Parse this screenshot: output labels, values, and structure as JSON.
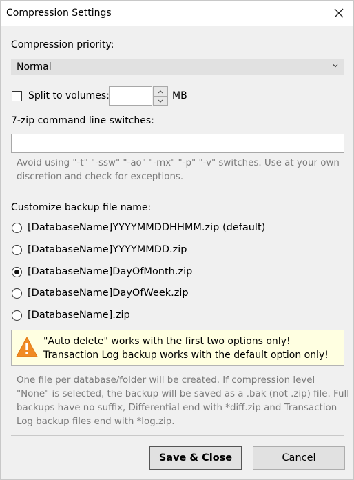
{
  "window": {
    "title": "Compression Settings"
  },
  "compression_priority": {
    "label": "Compression priority:",
    "selected": "Normal"
  },
  "split": {
    "label": "Split to volumes:",
    "checked": false,
    "value": "",
    "unit": "MB"
  },
  "switches": {
    "label": "7-zip command line switches:",
    "value": "",
    "hint_lines": [
      "Avoid using \"-t\" \"-ssw\" \"-ao\" \"-mx\" \"-p\" \"-v\" switches. Use at your own",
      "discretion and check for exceptions."
    ]
  },
  "backup_name": {
    "label": "Customize backup file name:",
    "options": [
      {
        "label": "[DatabaseName]YYYYMMDDHHMM.zip (default)",
        "checked": false
      },
      {
        "label": "[DatabaseName]YYYYMMDD.zip",
        "checked": false
      },
      {
        "label": "[DatabaseName]DayOfMonth.zip",
        "checked": true
      },
      {
        "label": "[DatabaseName]DayOfWeek.zip",
        "checked": false
      },
      {
        "label": "[DatabaseName].zip",
        "checked": false
      }
    ]
  },
  "warning": {
    "icon": "warning-icon",
    "lines": [
      "\"Auto delete\" works with the first two options only!",
      "Transaction Log backup works with the default option only!"
    ]
  },
  "info": {
    "lines": [
      "One file per database/folder will be created. If compression level",
      "\"None\" is selected, the backup will be saved as a .bak (not .zip) file. Full",
      "backups have no suffix, Differential end with *diff.zip and Transaction",
      "Log backup files end with *log.zip."
    ]
  },
  "buttons": {
    "save_close": "Save & Close",
    "cancel": "Cancel"
  },
  "colors": {
    "warning_bg": "#ffffe1",
    "warning_icon": "#f08a24",
    "hint_text": "#7a7a7a"
  }
}
